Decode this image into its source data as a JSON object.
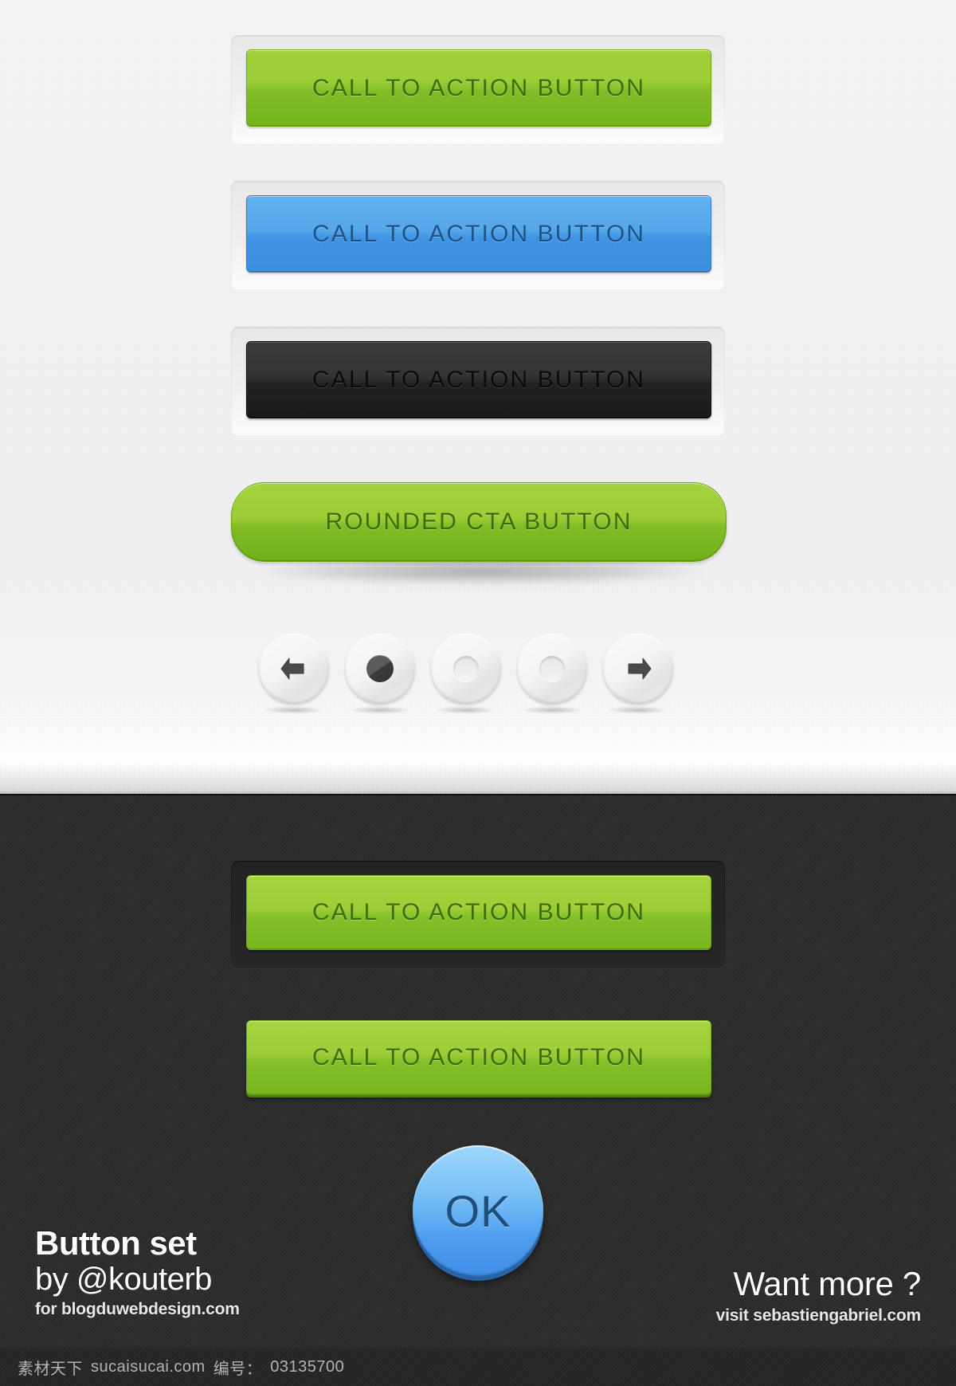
{
  "light_section": {
    "buttons": [
      {
        "id": "cta-green",
        "label": "CALL TO ACTION BUTTON",
        "style": "green",
        "color": "#8fc72e"
      },
      {
        "id": "cta-blue",
        "label": "CALL TO ACTION BUTTON",
        "style": "blue",
        "color": "#4d9de8"
      },
      {
        "id": "cta-dark",
        "label": "CALL TO ACTION BUTTON",
        "style": "dark",
        "color": "#2a2a2a"
      },
      {
        "id": "cta-pill",
        "label": "ROUNDED CTA BUTTON",
        "style": "green-pill",
        "color": "#8fc72e"
      }
    ],
    "pager": {
      "items": [
        {
          "name": "prev-arrow-button",
          "kind": "arrow-left"
        },
        {
          "name": "pager-dot-active",
          "kind": "dot-filled"
        },
        {
          "name": "pager-dot-1",
          "kind": "dot-empty"
        },
        {
          "name": "pager-dot-2",
          "kind": "dot-empty"
        },
        {
          "name": "next-arrow-button",
          "kind": "arrow-right"
        }
      ]
    }
  },
  "dark_section": {
    "buttons": [
      {
        "id": "cta-green-inset",
        "label": "CALL TO ACTION BUTTON",
        "style": "green-in-frame"
      },
      {
        "id": "cta-green-raised",
        "label": "CALL TO ACTION BUTTON",
        "style": "green-raised"
      }
    ],
    "ok_button": {
      "label": "OK",
      "color": "#58a6f0"
    },
    "credit_left": {
      "line1": "Button set",
      "line2": "by @kouterb",
      "line3": "for blogduwebdesign.com"
    },
    "credit_right": {
      "line1": "Want more ?",
      "line2": "visit sebastiengabriel.com"
    }
  },
  "watermark": {
    "site_cn": "素材天下",
    "site_url": "sucaisucai.com",
    "id_label": "编号：",
    "id_value": "03135700"
  }
}
